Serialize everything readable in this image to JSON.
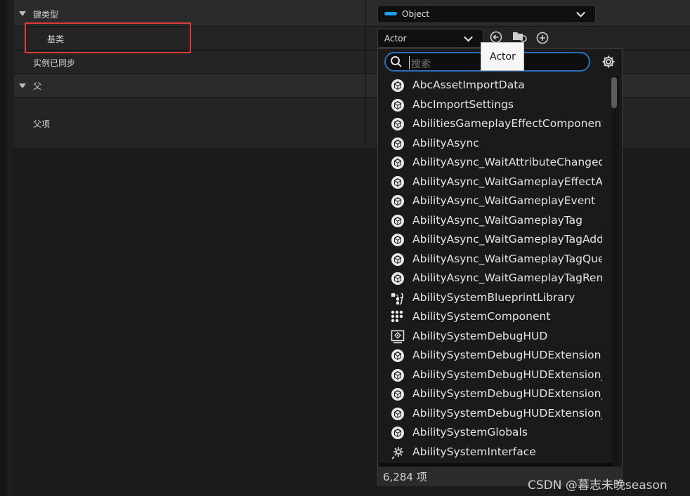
{
  "properties": {
    "key_type_header": "键类型",
    "key_type_value": "Object",
    "base_class_label": "基类",
    "base_class_value": "Actor",
    "instance_synced_label": "实例已同步",
    "parent_header": "父",
    "parent_item_label": "父项"
  },
  "tooltip": {
    "text": "Actor"
  },
  "picker": {
    "search_placeholder": "搜索",
    "items": [
      {
        "label": "AbcAssetImportData",
        "icon": "class-cube-icon"
      },
      {
        "label": "AbcImportSettings",
        "icon": "class-cube-icon"
      },
      {
        "label": "AbilitiesGameplayEffectComponent",
        "icon": "class-cube-icon"
      },
      {
        "label": "AbilityAsync",
        "icon": "class-cube-icon"
      },
      {
        "label": "AbilityAsync_WaitAttributeChanged",
        "icon": "class-cube-icon"
      },
      {
        "label": "AbilityAsync_WaitGameplayEffectApplied",
        "icon": "class-cube-icon"
      },
      {
        "label": "AbilityAsync_WaitGameplayEvent",
        "icon": "class-cube-icon"
      },
      {
        "label": "AbilityAsync_WaitGameplayTag",
        "icon": "class-cube-icon"
      },
      {
        "label": "AbilityAsync_WaitGameplayTagAdded",
        "icon": "class-cube-icon"
      },
      {
        "label": "AbilityAsync_WaitGameplayTagQuery",
        "icon": "class-cube-icon"
      },
      {
        "label": "AbilityAsync_WaitGameplayTagRemoved",
        "icon": "class-cube-icon"
      },
      {
        "label": "AbilitySystemBlueprintLibrary",
        "icon": "blueprint-library-icon"
      },
      {
        "label": "AbilitySystemComponent",
        "icon": "component-dots-icon"
      },
      {
        "label": "AbilitySystemDebugHUD",
        "icon": "hud-icon"
      },
      {
        "label": "AbilitySystemDebugHUDExtension",
        "icon": "class-cube-icon"
      },
      {
        "label": "AbilitySystemDebugHUDExtension_",
        "icon": "class-cube-icon"
      },
      {
        "label": "AbilitySystemDebugHUDExtension_",
        "icon": "class-cube-icon"
      },
      {
        "label": "AbilitySystemDebugHUDExtension_",
        "icon": "class-cube-icon"
      },
      {
        "label": "AbilitySystemGlobals",
        "icon": "class-cube-icon"
      },
      {
        "label": "AbilitySystemInterface",
        "icon": "interface-icon"
      }
    ],
    "count_label": "6,284 项"
  },
  "watermark": "CSDN @暮志未晚season",
  "colors": {
    "accent": "#1aa1f2",
    "highlight_border": "#e03b3b",
    "search_border": "#2a6fbf"
  }
}
